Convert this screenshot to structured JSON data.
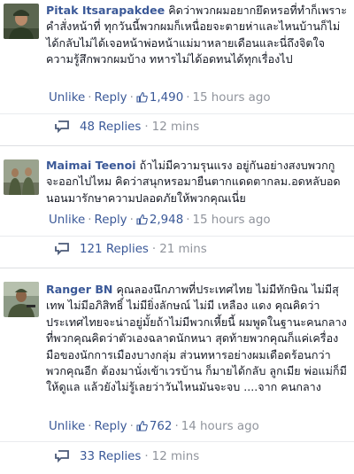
{
  "comments": [
    {
      "author": "Pitak Itsarapakdee",
      "text": "คิดว่าพวกผมอยากยึดหรอที่ทำก็เพราะคำสั่งหน้าที่ ทุกวันนี้พวกผมก็เหนื่อยจะตายห่าและไหนบ้านก็ไม่ได้กลับไม่ได้เจอหน้าพ่อหน้าแม่มาหลายเดือนและนี่ถึงจิตใจความรู้สึกพวกผมบ้าง ทหารไม่ได้อดทนได้ทุกเรื่องไป",
      "unlike_label": "Unlike",
      "reply_label": "Reply",
      "likes": "1,490",
      "time": "15 hours ago",
      "replies_label": "48 Replies",
      "replies_time": "12 mins"
    },
    {
      "author": "Maimai Teenoi",
      "text": "ถ้าไม่มีความรุนแรง อยู่กันอย่างสงบพวกกูจะออกไปไหม คิดว่าสนุกหรอมายืนตากแดดตากลม.อดหลับอดนอนมารักษาความปลอดภัยให้พวกคุณเนี่ย",
      "unlike_label": "Unlike",
      "reply_label": "Reply",
      "likes": "2,948",
      "time": "15 hours ago",
      "replies_label": "121 Replies",
      "replies_time": "21 mins"
    },
    {
      "author": "Ranger BN",
      "text": "คุณลองนึกภาพที่ประเทศไทย ไม่มีทักษิณ ไม่มีสุเทพ ไม่มีอภิสิทธิ์ ไม่มียิ่งลักษณ์ ไม่มี เหลือง แดง คุณคิดว่าประเทศไทยจะน่าอยู่มั้ยถ้าไม่มีพวกเหี้ยนี้ ผมพูดในฐานะคนกลางที่พวกคุณคิดว่าตัวเองฉลาดนักหนา สุดท้ายพวกคุณก็แค่เครื่องมือของนักการเมืองบางกลุ่ม ส่วนทหารอย่างผมเดือดร้อนกว่าพวกคุณอีก ต้องมานั่งเข้าเวรบ้าน ก็มายได้กลับ ลูกเมีย พ่อแม่ก็มีให้ดูแล แล้วยังไม่รู้เลยว่าวันไหนมันจะจบ ....จาก คนกลาง",
      "unlike_label": "Unlike",
      "reply_label": "Reply",
      "likes": "762",
      "time": "14 hours ago",
      "replies_label": "33 Replies",
      "replies_time": "12 mins"
    }
  ],
  "separator": "·",
  "colors": {
    "link": "#3b5998",
    "muted": "#90949c",
    "text": "#141823"
  }
}
